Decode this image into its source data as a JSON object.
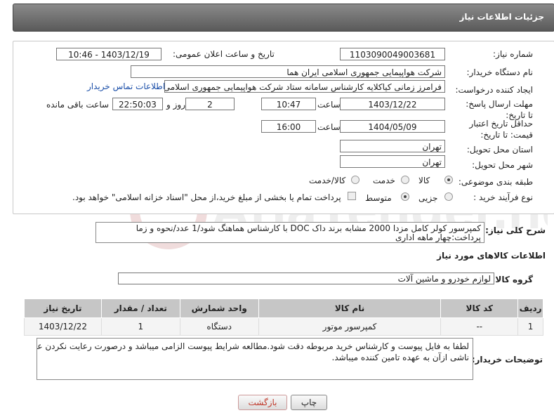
{
  "header": {
    "title": "جزئیات اطلاعات نیاز"
  },
  "form": {
    "need_number_label": "شماره نیاز:",
    "need_number": "1103090049003681",
    "announce_label": "تاریخ و ساعت اعلان عمومی:",
    "announce_value": "1403/12/19 - 10:46",
    "buyer_org_label": "نام دستگاه خریدار:",
    "buyer_org": "شرکت هواپیمایی جمهوری اسلامی ایران هما",
    "requester_label": "ایجاد کننده درخواست:",
    "requester": "فرامرز زمانی کیاکلایه کارشناس سامانه ستاد شرکت هواپیمایی جمهوری اسلامی ایران",
    "contact_link": "اطلاعات تماس خریدار",
    "deadline_label": "مهلت ارسال پاسخ: تا تاریخ:",
    "deadline_date": "1403/12/22",
    "time_label": "ساعت",
    "deadline_time": "10:47",
    "days": "2",
    "days_label": "روز و",
    "remaining": "22:50:03",
    "remaining_label": "ساعت باقی مانده",
    "validity_label": "حداقل تاریخ اعتبار قیمت: تا تاریخ:",
    "validity_date": "1404/05/09",
    "validity_time_label": "ساعت",
    "validity_time": "16:00",
    "province_label": "استان محل تحویل:",
    "province": "تهران",
    "city_label": "شهر محل تحویل:",
    "city": "تهران",
    "category_label": "طبقه بندی موضوعی:",
    "category_options": [
      "کالا",
      "خدمت",
      "کالا/خدمت"
    ],
    "process_label": "نوع فرآیند خرید :",
    "process_options": [
      "جزیی",
      "متوسط"
    ],
    "payment_note": "پرداخت تمام یا بخشی از مبلغ خرید،از محل \"اسناد خزانه اسلامی\" خواهد بود."
  },
  "description": {
    "label": "شرح کلی نیاز:",
    "text_line1": "کمپرسور کولر کامل مزدا 2000 مشابه برند داک DOC با کارشناس هماهنگ شود/1 عدد/نحوه و زما",
    "text_line2": "پرداخت:چهار ماهه اداری"
  },
  "goods": {
    "section_title": "اطلاعات کالاهای مورد نیاز",
    "group_label": "گروه کالا:",
    "group_value": "لوازم خودرو و ماشین آلات",
    "columns": [
      "ردیف",
      "کد کالا",
      "نام کالا",
      "واحد شمارش",
      "تعداد / مقدار",
      "تاریخ نیاز"
    ],
    "rows": [
      [
        "1",
        "--",
        "کمپرسور موتور",
        "دستگاه",
        "1",
        "1403/12/22"
      ]
    ]
  },
  "buyer_notes": {
    "label": "توضیحات خریدار:",
    "text_line1": "لطفا به فایل پیوست و کارشناس خرید مربوطه دقت شود.مطالعه شرایط پیوست الزامی میباشد و درصورت رعایت نکردن عواقب",
    "text_line2": "ناشی ازآن به عهده تامین کننده میباشد."
  },
  "buttons": {
    "print": "چاپ",
    "back": "بازگشت"
  },
  "colors": {
    "header_bg": "#6e6e6e",
    "link": "#1a4ea8",
    "table_header": "#c6c6c6",
    "back_text": "#c0392b"
  }
}
